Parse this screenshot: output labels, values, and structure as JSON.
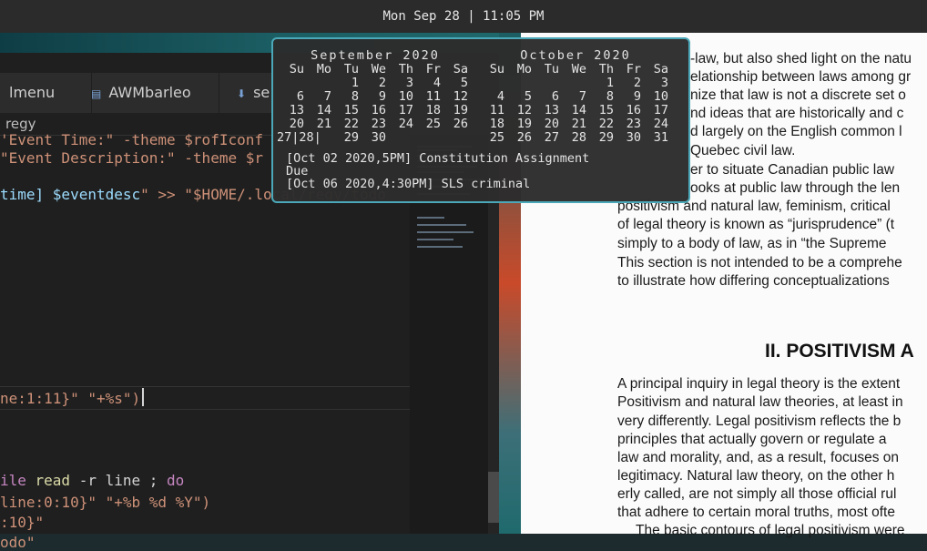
{
  "topbar": {
    "clock": "Mon Sep 28 | 11:05 PM"
  },
  "editor": {
    "tabs": [
      {
        "label": "lmenu",
        "icon": ""
      },
      {
        "label": "AWMbarleo",
        "icon": "file-icon"
      },
      {
        "label": "se",
        "icon": "download-icon"
      }
    ],
    "breadcrumb": "regy",
    "lines": [
      {
        "parts": [
          {
            "t": "'Event Time:\" -theme $rofIconf",
            "c": "s"
          }
        ]
      },
      {
        "parts": [
          {
            "t": "\"Event Description:\" -theme $r",
            "c": "s"
          }
        ]
      },
      {
        "parts": [
          {
            "t": "time] ",
            "c": "v"
          },
          {
            "t": "$eventdesc",
            "c": "v"
          },
          {
            "t": "\" >> \"$HOME/.local/regy/todo",
            "c": "s"
          }
        ]
      },
      {
        "parts": [
          {
            "t": "ne:1:11}\" \"+%s\")",
            "c": "s"
          }
        ]
      },
      {
        "parts": [
          {
            "t": "ile ",
            "c": "k"
          },
          {
            "t": "read",
            "c": "f"
          },
          {
            "t": " -r line ; ",
            "c": ""
          },
          {
            "t": "do",
            "c": "k"
          }
        ]
      },
      {
        "parts": [
          {
            "t": "line:0:10}\" \"+%b %d %Y\")",
            "c": "s"
          }
        ]
      },
      {
        "parts": [
          {
            "t": ":10}\"",
            "c": "s"
          }
        ]
      },
      {
        "parts": [
          {
            "t": "odo\"",
            "c": "s"
          }
        ]
      }
    ]
  },
  "calendar": {
    "months": [
      {
        "title": "September 2020",
        "header": [
          "Su",
          "Mo",
          "Tu",
          "We",
          "Th",
          "Fr",
          "Sa"
        ],
        "weeks": [
          [
            "",
            "",
            "1",
            "2",
            "3",
            "4",
            "5"
          ],
          [
            "6",
            "7",
            "8",
            "9",
            "10",
            "11",
            "12"
          ],
          [
            "13",
            "14",
            "15",
            "16",
            "17",
            "18",
            "19"
          ],
          [
            "20",
            "21",
            "22",
            "23",
            "24",
            "25",
            "26"
          ],
          [
            "27|28|",
            "",
            "29",
            "30",
            "",
            "",
            ""
          ]
        ]
      },
      {
        "title": "October 2020",
        "header": [
          "Su",
          "Mo",
          "Tu",
          "We",
          "Th",
          "Fr",
          "Sa"
        ],
        "weeks": [
          [
            "",
            "",
            "",
            "",
            "1",
            "2",
            "3"
          ],
          [
            "4",
            "5",
            "6",
            "7",
            "8",
            "9",
            "10"
          ],
          [
            "11",
            "12",
            "13",
            "14",
            "15",
            "16",
            "17"
          ],
          [
            "18",
            "19",
            "20",
            "21",
            "22",
            "23",
            "24"
          ],
          [
            "25",
            "26",
            "27",
            "28",
            "29",
            "30",
            "31"
          ]
        ]
      }
    ],
    "events": [
      "[Oct 02 2020,5PM] Constitution Assignment",
      "Due",
      "[Oct 06 2020,4:30PM] SLS criminal"
    ]
  },
  "document": {
    "lines": [
      "-law, but also shed light on the natu",
      "elationship between laws among gr",
      "nize that law is not a discrete set o",
      "nd ideas that are historically and c",
      "d largely on the English common l",
      "Quebec civil law.",
      "er to situate Canadian public law",
      "ooks at public law through the len",
      "positivism and natural law, feminism, critical",
      "of legal theory is known as “jurisprudence” (t",
      "simply to a body of law, as in “the Supreme",
      "This section is not intended to be a comprehe",
      "to illustrate how differing conceptualizations"
    ],
    "heading": "II.  POSITIVISM A",
    "lines2": [
      "A principal inquiry in legal theory is the extent",
      "Positivism and natural law theories, at least in",
      "very differently. Legal positivism reflects the b",
      "principles that actually govern or regulate a",
      "law and morality, and, as a result, focuses on",
      "legitimacy. Natural law theory, on the other h",
      "erly called, are not simply all those official rul",
      "that adhere to certain moral truths, most ofte",
      "The basic contours of legal positivism were"
    ]
  }
}
